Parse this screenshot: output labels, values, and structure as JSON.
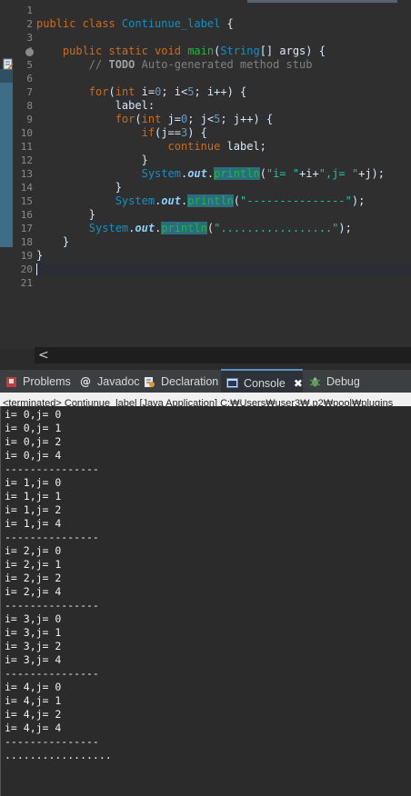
{
  "editor": {
    "line_numbers": [
      "1",
      "2",
      "3",
      "4",
      "5",
      "6",
      "7",
      "8",
      "9",
      "10",
      "11",
      "12",
      "13",
      "14",
      "15",
      "16",
      "17",
      "18",
      "19",
      "20",
      "21"
    ],
    "lines": [
      [],
      [
        [
          "kw",
          "public class "
        ],
        [
          "cls",
          "Contiunue_label"
        ],
        [
          "plain",
          " {"
        ]
      ],
      [],
      [
        [
          "plain",
          "    "
        ],
        [
          "kw",
          "public static void "
        ],
        [
          "mth",
          "main"
        ],
        [
          "plain",
          "("
        ],
        [
          "cls",
          "String"
        ],
        [
          "plain",
          "[] "
        ],
        [
          "plain",
          "args"
        ],
        [
          "plain",
          ") {"
        ]
      ],
      [
        [
          "plain",
          "        "
        ],
        [
          "cmt",
          "// "
        ],
        [
          "todo",
          "TODO"
        ],
        [
          "cmt",
          " Auto-generated method stub"
        ]
      ],
      [],
      [
        [
          "plain",
          "        "
        ],
        [
          "kw",
          "for"
        ],
        [
          "plain",
          "("
        ],
        [
          "kw",
          "int "
        ],
        [
          "plain",
          "i="
        ],
        [
          "num",
          "0"
        ],
        [
          "plain",
          "; i<"
        ],
        [
          "num",
          "5"
        ],
        [
          "plain",
          "; i++) {"
        ]
      ],
      [
        [
          "plain",
          "            label:"
        ]
      ],
      [
        [
          "plain",
          "            "
        ],
        [
          "kw",
          "for"
        ],
        [
          "plain",
          "("
        ],
        [
          "kw",
          "int "
        ],
        [
          "plain",
          "j="
        ],
        [
          "num",
          "0"
        ],
        [
          "plain",
          "; j<"
        ],
        [
          "num",
          "5"
        ],
        [
          "plain",
          "; j++) {"
        ]
      ],
      [
        [
          "plain",
          "                "
        ],
        [
          "kw",
          "if"
        ],
        [
          "plain",
          "(j=="
        ],
        [
          "num",
          "3"
        ],
        [
          "plain",
          ") {"
        ]
      ],
      [
        [
          "plain",
          "                    "
        ],
        [
          "kw",
          "continue "
        ],
        [
          "plain",
          "label;"
        ]
      ],
      [
        [
          "plain",
          "                }"
        ]
      ],
      [
        [
          "plain",
          "                "
        ],
        [
          "cls",
          "System"
        ],
        [
          "plain",
          "."
        ],
        [
          "fld",
          "out"
        ],
        [
          "plain",
          "."
        ],
        [
          "hl",
          "println"
        ],
        [
          "plain",
          "("
        ],
        [
          "str",
          "\"i= \""
        ],
        [
          "plain",
          "+i+"
        ],
        [
          "str",
          "\",j= \""
        ],
        [
          "plain",
          "+j);"
        ]
      ],
      [
        [
          "plain",
          "            }"
        ]
      ],
      [
        [
          "plain",
          "            "
        ],
        [
          "cls",
          "System"
        ],
        [
          "plain",
          "."
        ],
        [
          "fld",
          "out"
        ],
        [
          "plain",
          "."
        ],
        [
          "hl",
          "println"
        ],
        [
          "plain",
          "("
        ],
        [
          "str",
          "\"---------------\""
        ],
        [
          "plain",
          ");"
        ]
      ],
      [
        [
          "plain",
          "        }"
        ]
      ],
      [
        [
          "plain",
          "        "
        ],
        [
          "cls",
          "System"
        ],
        [
          "plain",
          "."
        ],
        [
          "fld",
          "out"
        ],
        [
          "plain",
          "."
        ],
        [
          "hl",
          "println"
        ],
        [
          "plain",
          "("
        ],
        [
          "str",
          "\".................\""
        ],
        [
          "plain",
          ");"
        ]
      ],
      [
        [
          "plain",
          "    }"
        ]
      ],
      [
        [
          "plain",
          "}"
        ]
      ],
      [],
      []
    ],
    "scroll_left_glyph": "<"
  },
  "views": {
    "tabs": [
      {
        "label": "Problems",
        "icon": "problems-icon"
      },
      {
        "label": "Javadoc",
        "icon": "javadoc-icon"
      },
      {
        "label": "Declaration",
        "icon": "declaration-icon"
      },
      {
        "label": "Console",
        "icon": "console-icon"
      },
      {
        "label": "Debug",
        "icon": "debug-icon"
      }
    ],
    "close_glyph": "✖"
  },
  "console": {
    "header": "<terminated> Contiunue_label [Java Application] C:₩Users₩user3₩.p2₩pool₩plugins",
    "output": [
      "i= 0,j= 0",
      "i= 0,j= 1",
      "i= 0,j= 2",
      "i= 0,j= 4",
      "---------------",
      "i= 1,j= 0",
      "i= 1,j= 1",
      "i= 1,j= 2",
      "i= 1,j= 4",
      "---------------",
      "i= 2,j= 0",
      "i= 2,j= 1",
      "i= 2,j= 2",
      "i= 2,j= 4",
      "---------------",
      "i= 3,j= 0",
      "i= 3,j= 1",
      "i= 3,j= 2",
      "i= 3,j= 4",
      "---------------",
      "i= 4,j= 0",
      "i= 4,j= 1",
      "i= 4,j= 2",
      "i= 4,j= 4",
      "---------------",
      "................."
    ]
  },
  "colors": {
    "editor_bg": "#2f2f2f",
    "keyword": "#cc6c1d",
    "class": "#1290c3",
    "method": "#1eb540",
    "string": "#17c6a3",
    "console_bg": "#2b2b2b",
    "active_tab_accent": "#5c8fbf"
  }
}
